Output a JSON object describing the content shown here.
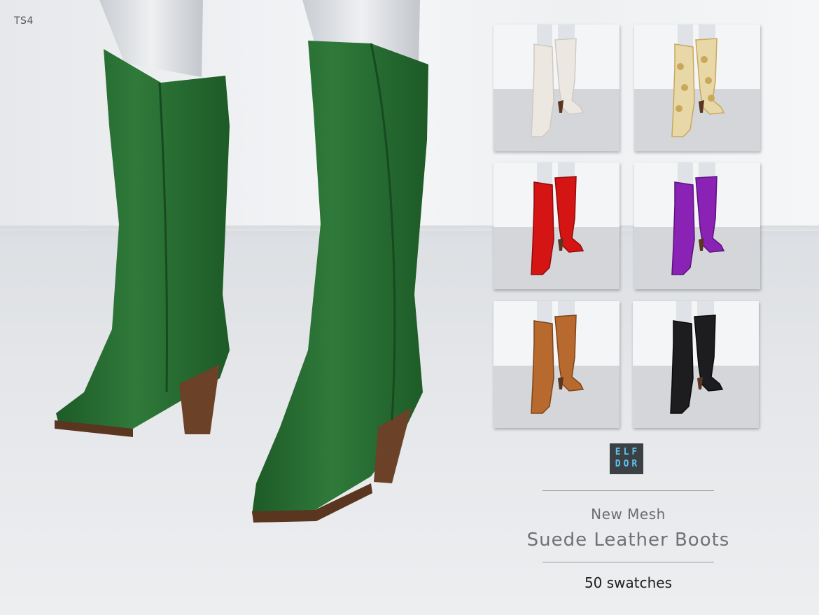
{
  "game_tag": "TS4",
  "logo": {
    "line1": "ELF",
    "line2": "DOR"
  },
  "subtitle": "New Mesh",
  "title": "Suede Leather Boots",
  "swatch_count": "50 swatches",
  "hero": {
    "color": "#2f7a3a",
    "color_dark": "#1d5a27",
    "heel": "#6b4127"
  },
  "thumbnails": [
    {
      "color": "#ece8e1",
      "shade": "#cfcac2",
      "pattern": "solid"
    },
    {
      "color": "#e8d8a8",
      "shade": "#c9a85a",
      "pattern": "floral"
    },
    {
      "color": "#d51414",
      "shade": "#8e0b0b",
      "pattern": "solid"
    },
    {
      "color": "#8a22b5",
      "shade": "#5a1378",
      "pattern": "solid"
    },
    {
      "color": "#b86a2e",
      "shade": "#7d4419",
      "pattern": "solid"
    },
    {
      "color": "#1d1d1f",
      "shade": "#0a0a0b",
      "pattern": "solid"
    }
  ]
}
